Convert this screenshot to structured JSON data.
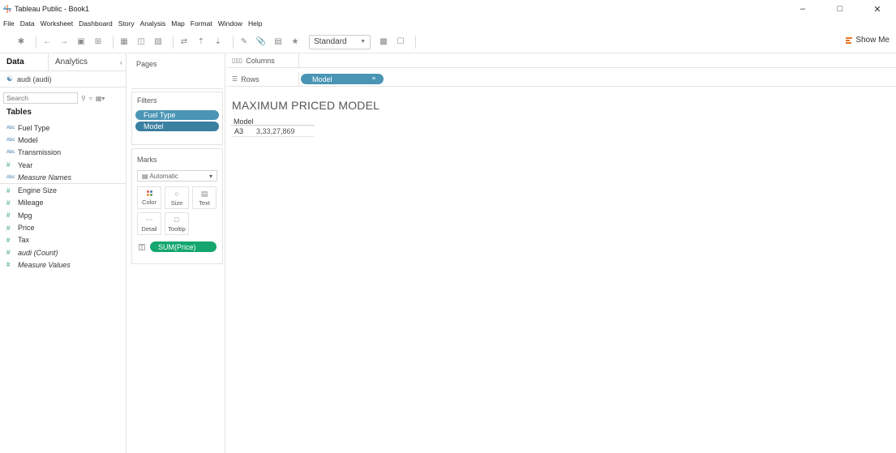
{
  "window": {
    "title": "Tableau Public - Book1",
    "minimize": "–",
    "maximize": "□",
    "close": "✕"
  },
  "menu": [
    "File",
    "Data",
    "Worksheet",
    "Dashboard",
    "Story",
    "Analysis",
    "Map",
    "Format",
    "Window",
    "Help"
  ],
  "toolbar": {
    "fit_select": "Standard",
    "show_me": "Show Me"
  },
  "data_pane": {
    "tab_data": "Data",
    "tab_analytics": "Analytics",
    "collapse": "‹",
    "datasource": "audi (audi)",
    "search_placeholder": "Search",
    "tables_heading": "Tables",
    "dimensions": [
      {
        "type": "Abc",
        "name": "Fuel Type"
      },
      {
        "type": "Abc",
        "name": "Model"
      },
      {
        "type": "Abc",
        "name": "Transmission"
      },
      {
        "type": "#",
        "name": "Year"
      },
      {
        "type": "Abc",
        "name": "Measure Names"
      }
    ],
    "measures": [
      {
        "type": "#",
        "name": "Engine Size"
      },
      {
        "type": "#",
        "name": "Mileage"
      },
      {
        "type": "#",
        "name": "Mpg"
      },
      {
        "type": "#",
        "name": "Price"
      },
      {
        "type": "#",
        "name": "Tax"
      },
      {
        "type": "#",
        "name": "audi (Count)"
      },
      {
        "type": "#",
        "name": "Measure Values"
      }
    ]
  },
  "cards": {
    "pages_title": "Pages",
    "filters_title": "Filters",
    "filters": [
      "Fuel Type",
      "Model"
    ],
    "marks_title": "Marks",
    "mark_type": "Automatic",
    "mark_buttons": {
      "color": "Color",
      "size": "Size",
      "text": "Text",
      "detail": "Detail",
      "tooltip": "Tooltip"
    },
    "mark_field": "SUM(Price)"
  },
  "shelves": {
    "columns_label": "Columns",
    "rows_label": "Rows",
    "rows_pill": "Model"
  },
  "viz": {
    "title": "MAXIMUM PRICED MODEL",
    "column_header": "Model",
    "rows": [
      {
        "label": "A3",
        "value": "3,33,27,869"
      }
    ]
  }
}
